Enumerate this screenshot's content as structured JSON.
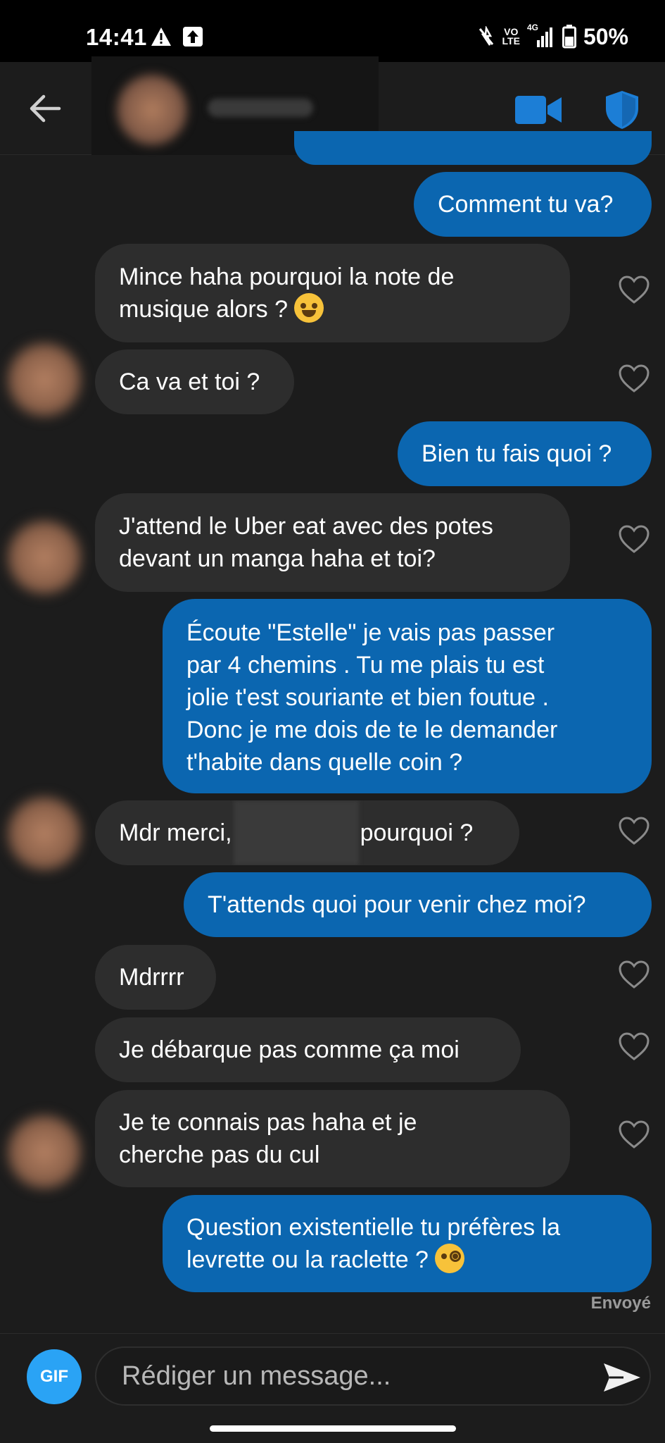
{
  "status_bar": {
    "time": "14:41",
    "network_top": "VO",
    "network_bottom": "LTE",
    "signal_label": "4G",
    "battery": "50%"
  },
  "header": {
    "back_icon": "arrow-left-icon",
    "video_icon": "video-camera-icon",
    "shield_icon": "shield-icon",
    "accent_color": "#1c7ed6"
  },
  "messages": [
    {
      "id": "m1",
      "direction": "out",
      "text": "Comment tu va?"
    },
    {
      "id": "m2",
      "direction": "in",
      "line1": "Mince haha pourquoi la note de",
      "line2": "musique alors ?",
      "emoji": "grinning-sweat-emoji"
    },
    {
      "id": "m3",
      "direction": "in",
      "text": "Ca va et toi ?"
    },
    {
      "id": "m4",
      "direction": "out",
      "text": "Bien tu fais quoi ?"
    },
    {
      "id": "m5",
      "direction": "in",
      "line1": "J'attend le Uber eat avec des potes",
      "line2": "devant un manga haha et toi?"
    },
    {
      "id": "m6",
      "direction": "out",
      "line1": "Écoute \"Estelle\" je vais pas passer",
      "line2": "par 4 chemins . Tu me plais tu est",
      "line3": "jolie t'est souriante et bien foutue .",
      "line4": "Donc je me dois de te le demander",
      "line5": "t'habite dans quelle coin ?"
    },
    {
      "id": "m7",
      "direction": "in",
      "before": "Mdr merci,",
      "after": "pourquoi ?"
    },
    {
      "id": "m8",
      "direction": "out",
      "text": "T'attends quoi pour venir chez moi?"
    },
    {
      "id": "m9",
      "direction": "in",
      "text": "Mdrrrr"
    },
    {
      "id": "m10",
      "direction": "in",
      "text": "Je débarque pas comme ça moi"
    },
    {
      "id": "m11",
      "direction": "in",
      "line1": "Je te connais pas haha et je",
      "line2": "cherche pas du cul"
    },
    {
      "id": "m12",
      "direction": "out",
      "line1": "Question existentielle tu préfères la",
      "line2": "levrette ou la raclette ?",
      "emoji": "face-with-monocle-emoji"
    }
  ],
  "sent_status": "Envoyé",
  "composer": {
    "gif_label": "GIF",
    "placeholder": "Rédiger un message...",
    "send_icon": "send-icon"
  },
  "colors": {
    "outgoing_bubble": "#0b66b0",
    "incoming_bubble": "#2d2d2d",
    "background": "#1c1c1c",
    "gif_button": "#2aa3f5"
  }
}
